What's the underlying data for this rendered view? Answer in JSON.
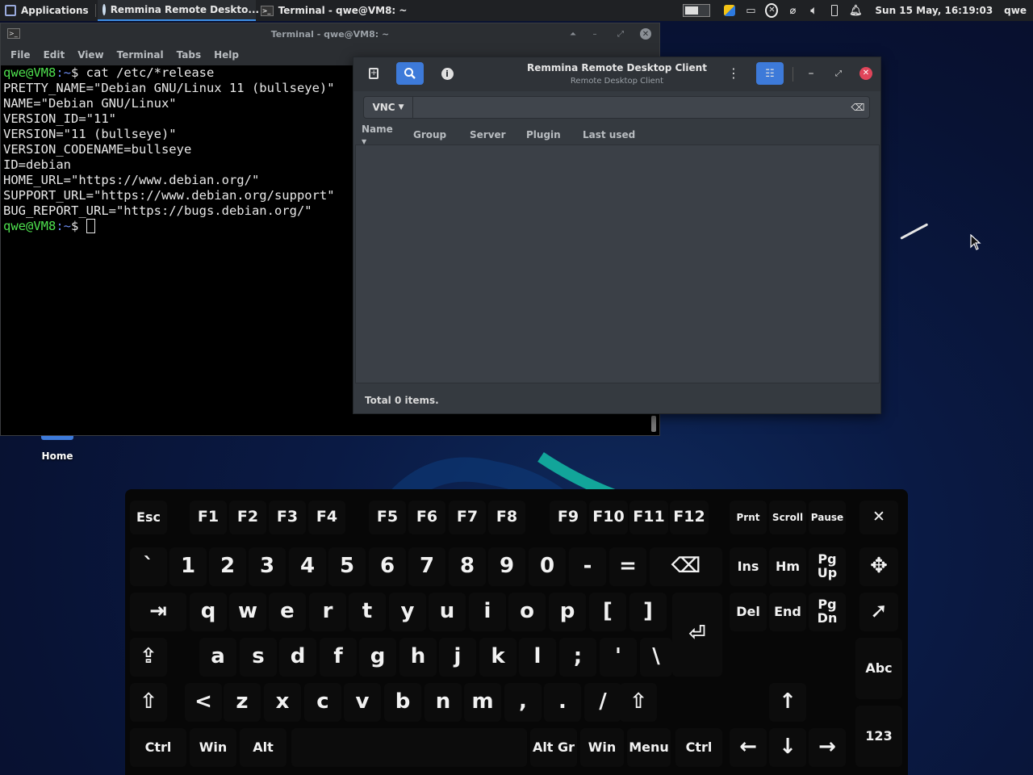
{
  "panel": {
    "applications": "Applications",
    "tasks": [
      {
        "label": "Remmina Remote Deskto...",
        "active": true
      },
      {
        "label": "Terminal - qwe@VM8: ~",
        "active": false
      }
    ],
    "clock": "Sun 15 May, 16:19:03",
    "user": "qwe"
  },
  "terminal": {
    "title": "Terminal - qwe@VM8: ~",
    "menu": [
      "File",
      "Edit",
      "View",
      "Terminal",
      "Tabs",
      "Help"
    ],
    "prompt_user": "qwe@VM8",
    "prompt_path": ":~",
    "prompt_symbol": "$ ",
    "command": "cat /etc/*release",
    "output": [
      "PRETTY_NAME=\"Debian GNU/Linux 11 (bullseye)\"",
      "NAME=\"Debian GNU/Linux\"",
      "VERSION_ID=\"11\"",
      "VERSION=\"11 (bullseye)\"",
      "VERSION_CODENAME=bullseye",
      "ID=debian",
      "HOME_URL=\"https://www.debian.org/\"",
      "SUPPORT_URL=\"https://www.debian.org/support\"",
      "BUG_REPORT_URL=\"https://bugs.debian.org/\""
    ]
  },
  "remmina": {
    "title": "Remmina Remote Desktop Client",
    "subtitle": "Remote Desktop Client",
    "protocol": "VNC",
    "quick_connect_value": "",
    "columns": [
      "Name",
      "Group",
      "Server",
      "Plugin",
      "Last used"
    ],
    "status": "Total 0 items."
  },
  "desktop": {
    "home_label": "Home"
  },
  "keyboard": {
    "row_fn": [
      "Esc",
      "F1",
      "F2",
      "F3",
      "F4",
      "F5",
      "F6",
      "F7",
      "F8",
      "F9",
      "F10",
      "F11",
      "F12",
      "Prnt",
      "Scroll",
      "Pause",
      "✕"
    ],
    "row_num": [
      "`",
      "1",
      "2",
      "3",
      "4",
      "5",
      "6",
      "7",
      "8",
      "9",
      "0",
      "-",
      "=",
      "⌫",
      "Ins",
      "Hm",
      "Pg\nUp",
      "✥"
    ],
    "row_q": [
      "⇥",
      "q",
      "w",
      "e",
      "r",
      "t",
      "y",
      "u",
      "i",
      "o",
      "p",
      "[",
      "]",
      "⏎",
      "Del",
      "End",
      "Pg\nDn",
      "➚"
    ],
    "row_a": [
      "⇪",
      "a",
      "s",
      "d",
      "f",
      "g",
      "h",
      "j",
      "k",
      "l",
      ";",
      "'",
      "\\",
      "Abc"
    ],
    "row_z": [
      "⇧",
      "<",
      "z",
      "x",
      "c",
      "v",
      "b",
      "n",
      "m",
      ",",
      ".",
      "/",
      "⇧",
      "↑"
    ],
    "row_ctrl": [
      "Ctrl",
      "Win",
      "Alt",
      "Alt Gr",
      "Win",
      "Menu",
      "Ctrl",
      "←",
      "↓",
      "→",
      "123"
    ]
  },
  "colors": {
    "accent": "#3d7ad9",
    "prompt_green": "#4ee04e",
    "prompt_blue": "#6c8cf0",
    "close_red": "#e0455a"
  }
}
